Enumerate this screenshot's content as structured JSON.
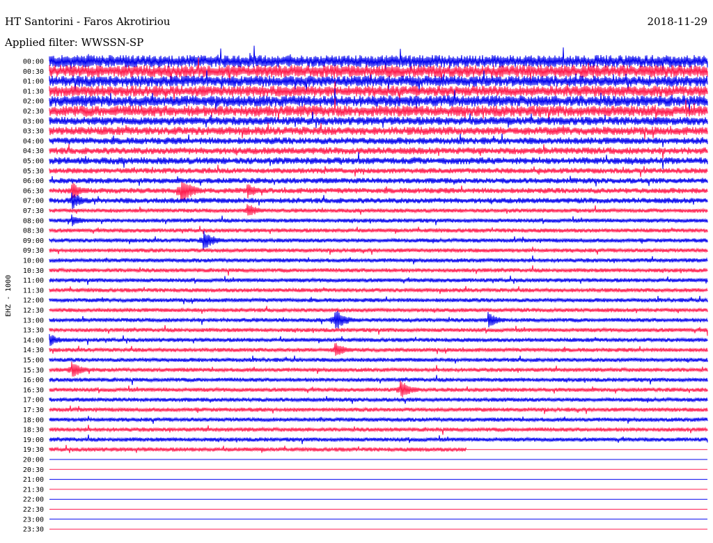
{
  "header": {
    "station": "HT Santorini - Faros Akrotiriou",
    "date": "2018-11-29",
    "filter": "Applied filter: WWSSN-SP"
  },
  "channel_label": "EHZ - 1000",
  "colors": {
    "trace_a": "#0000ee",
    "trace_b": "#ff1a4d",
    "background": "#ffffff",
    "text": "#000000"
  },
  "chart_data": {
    "type": "line",
    "title": "HT Santorini - Faros Akrotiriou",
    "ylabel": "EHZ - 1000",
    "xlabel": "",
    "grid": false,
    "legend": "none",
    "rows": [
      "00:00",
      "00:30",
      "01:00",
      "01:30",
      "02:00",
      "02:30",
      "03:00",
      "03:30",
      "04:00",
      "04:30",
      "05:00",
      "05:30",
      "06:00",
      "06:30",
      "07:00",
      "07:30",
      "08:00",
      "08:30",
      "09:00",
      "09:30",
      "10:00",
      "10:30",
      "11:00",
      "11:30",
      "12:00",
      "12:30",
      "13:00",
      "13:30",
      "14:00",
      "14:30",
      "15:00",
      "15:30",
      "16:00",
      "16:30",
      "17:00",
      "17:30",
      "18:00",
      "18:30",
      "19:00",
      "19:30",
      "20:00",
      "20:30",
      "21:00",
      "21:30",
      "22:00",
      "22:30",
      "23:00",
      "23:30"
    ],
    "row_minutes": 30,
    "trace_colors_alternating": [
      "blue",
      "red"
    ],
    "recorded_until": "19:49",
    "noise_level_by_row": [
      9,
      9,
      8,
      8,
      8,
      8,
      6,
      6,
      5,
      5,
      5,
      4,
      4,
      4,
      4,
      3,
      3,
      3,
      3,
      3,
      3,
      3,
      3,
      3,
      3,
      3,
      3,
      3,
      3,
      3,
      3,
      3,
      3,
      3,
      3,
      3,
      3,
      3,
      3,
      3,
      0,
      0,
      0,
      0,
      0,
      0,
      0,
      0
    ],
    "events": [
      {
        "time": "06:31",
        "amplitude": 14
      },
      {
        "time": "06:36",
        "amplitude": 22
      },
      {
        "time": "06:39",
        "amplitude": 12
      },
      {
        "time": "07:01",
        "amplitude": 14
      },
      {
        "time": "07:39",
        "amplitude": 12
      },
      {
        "time": "08:01",
        "amplitude": 10
      },
      {
        "time": "09:07",
        "amplitude": 16
      },
      {
        "time": "13:13",
        "amplitude": 18
      },
      {
        "time": "13:20",
        "amplitude": 12
      },
      {
        "time": "14:00",
        "amplitude": 10
      },
      {
        "time": "14:43",
        "amplitude": 12
      },
      {
        "time": "15:31",
        "amplitude": 14
      },
      {
        "time": "16:46",
        "amplitude": 15
      }
    ]
  }
}
